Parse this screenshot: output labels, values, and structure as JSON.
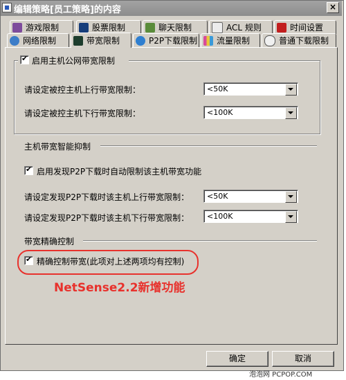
{
  "window": {
    "title": "编辑策略[员工策略]的内容",
    "close_symbol": "×"
  },
  "tabs_row1": [
    {
      "label": "游戏限制",
      "icon": "gamepad-icon"
    },
    {
      "label": "股票限制",
      "icon": "stock-chart-icon"
    },
    {
      "label": "聊天限制",
      "icon": "chat-people-icon"
    },
    {
      "label": "ACL 规则",
      "icon": "rule-pen-icon"
    },
    {
      "label": "时间设置",
      "icon": "clock-icon"
    }
  ],
  "tabs_row2": [
    {
      "label": "网络限制",
      "icon": "network-icon"
    },
    {
      "label": "带宽限制",
      "icon": "bandwidth-icon",
      "active": true
    },
    {
      "label": "P2P下载限制",
      "icon": "p2p-icon"
    },
    {
      "label": "流量限制",
      "icon": "traffic-chart-icon"
    },
    {
      "label": "普通下载限制",
      "icon": "download-icon"
    }
  ],
  "host_bandwidth": {
    "enable_label": "启用主机公网带宽限制",
    "enabled": true,
    "upload_label": "请设定被控主机上行带宽限制：",
    "upload_value": "<50K",
    "download_label": "请设定被控主机下行带宽限制：",
    "download_value": "<100K"
  },
  "smart_suppress": {
    "header": "主机带宽智能抑制",
    "enable_label": "启用发现P2P下载时自动限制该主机带宽功能",
    "enabled": true,
    "upload_label": "请设定发现P2P下载时该主机上行带宽限制：",
    "upload_value": "<50K",
    "download_label": "请设定发现P2P下载时该主机下行带宽限制：",
    "download_value": "<100K"
  },
  "precise_control": {
    "header": "带宽精确控制",
    "enable_label": "精确控制带宽(此项对上述两项均有控制)",
    "enabled": true,
    "annotation": "NetSense2.2新增功能"
  },
  "buttons": {
    "ok": "确定",
    "cancel": "取消"
  },
  "watermark": "泡泡网 PCPOP.COM",
  "colors": {
    "dialog_bg": "#d4d0c8",
    "annotation_red": "#e8312c"
  }
}
